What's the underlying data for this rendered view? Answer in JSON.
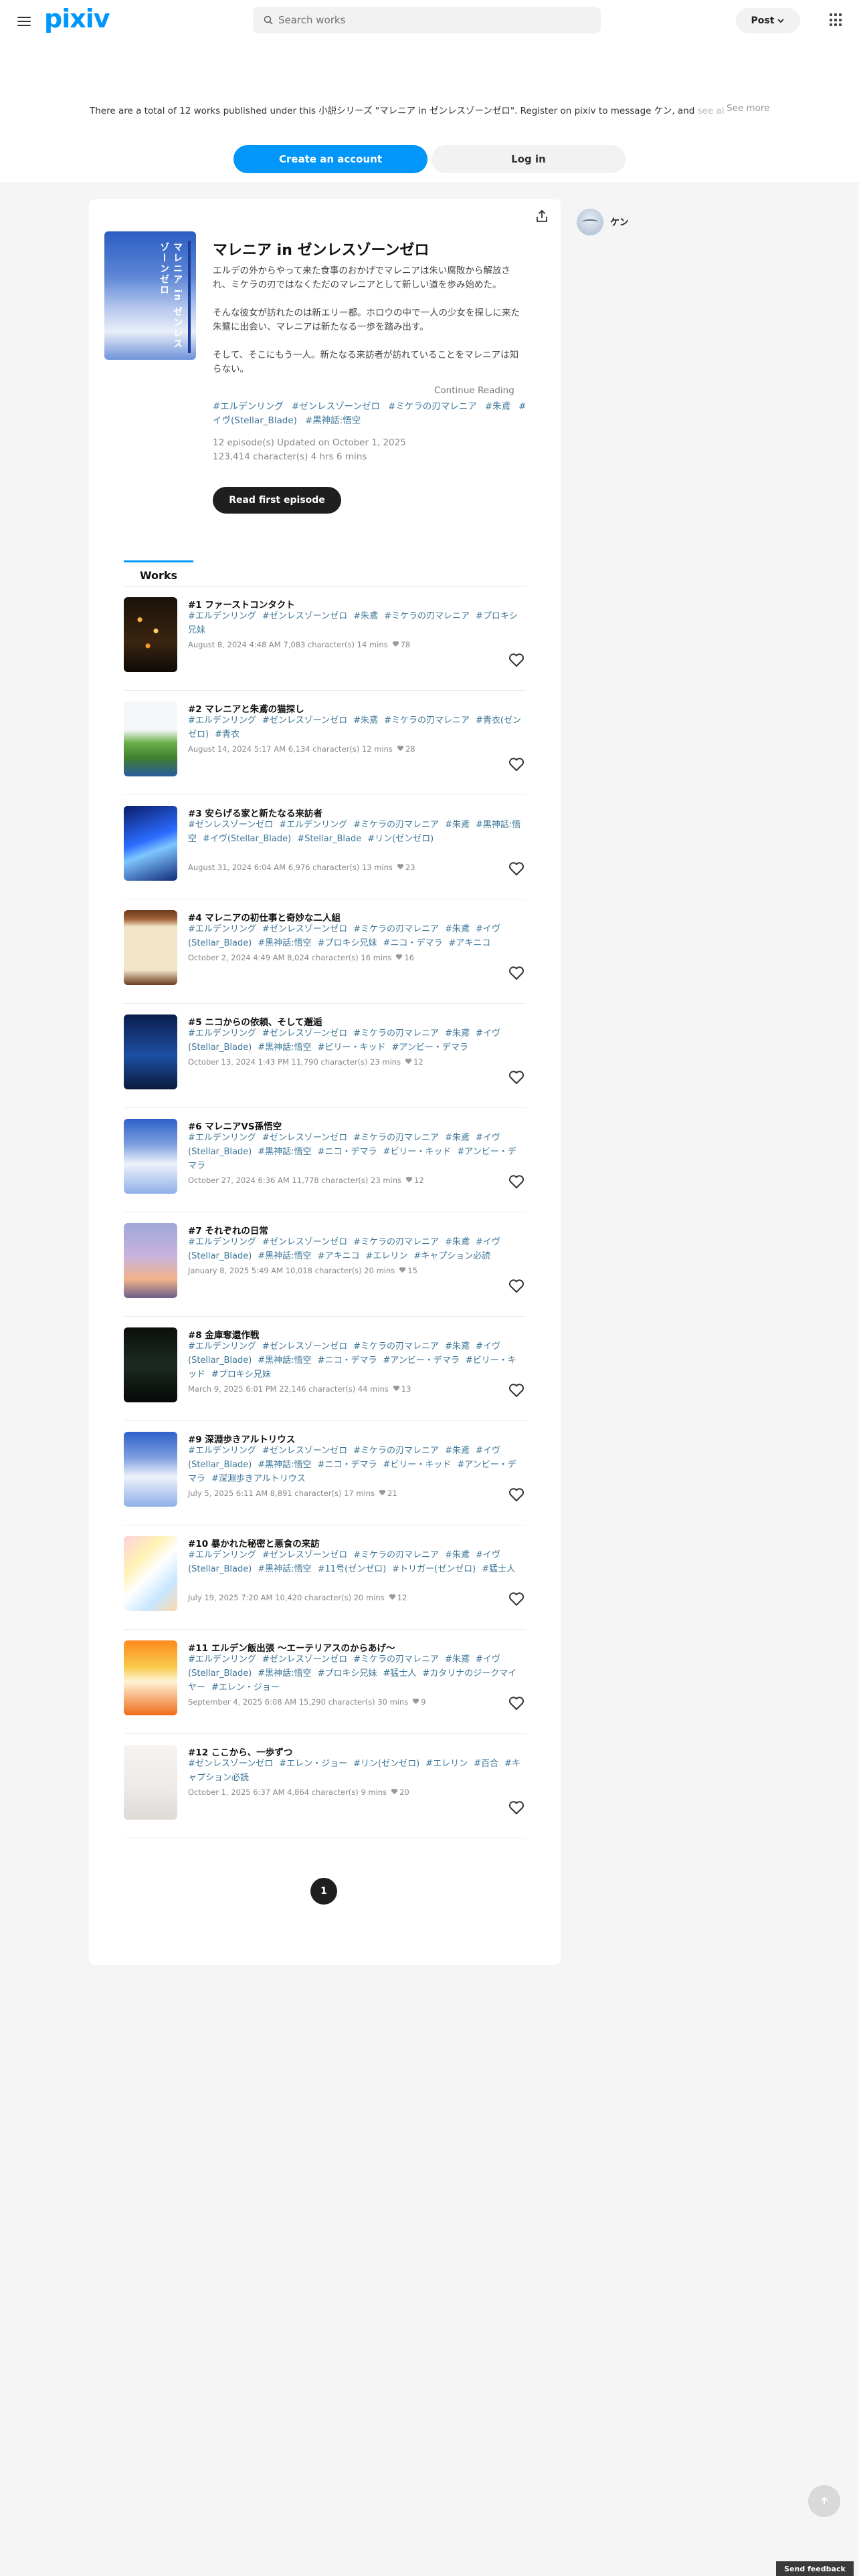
{
  "header": {
    "logo": "pixiv",
    "search_placeholder": "Search works",
    "post_label": "Post"
  },
  "intro": {
    "text": "There are a total of 12 works published under this 小説シリーズ \"マレニア in ゼンレスゾーンゼロ\". Register on pixiv to message ケン, and",
    "text_fade": " see all series",
    "see_more": "See more",
    "create_account": "Create an account",
    "log_in": "Log in"
  },
  "series": {
    "cover_title": "マレニア in ゼンレスゾーンゼロ",
    "title": "マレニア in ゼンレスゾーンゼロ",
    "desc1": "エルデの外からやって来た食事のおかげでマレニアは朱い腐敗から解放され、ミケラの刃ではなくただのマレニアとして新しい道を歩み始めた。",
    "desc2": "そんな彼女が訪れたのは新エリー都。ホロウの中で一人の少女を探しに来た朱鷺に出会い、マレニアは新たなる一歩を踏み出す。",
    "desc3": "そして、そこにもう一人。新たなる来訪者が訪れていることをマレニアは知らない。",
    "continue_reading": "Continue Reading",
    "tags": [
      "#エルデンリング",
      "#ゼンレスゾーンゼロ",
      "#ミケラの刃マレニア",
      "#朱鳶",
      "#イヴ(Stellar_Blade)",
      "#黒神話:悟空"
    ],
    "meta_line1": "12 episode(s)  Updated on October 1, 2025",
    "meta_line2": "123,414 character(s)  4 hrs 6 mins",
    "read_first": "Read first episode"
  },
  "tabs": {
    "works": "Works"
  },
  "episodes": [
    {
      "title": "#1 ファーストコンタクト",
      "tags": [
        "#エルデンリング",
        "#ゼンレスゾーンゼロ",
        "#朱鳶",
        "#ミケラの刃マレニア",
        "#プロキシ兄妹"
      ],
      "meta": "August 8, 2024 4:48 AM  7,083 character(s)  14 mins",
      "likes": "78"
    },
    {
      "title": "#2 マレニアと朱鳶の猫探し",
      "tags": [
        "#エルデンリング",
        "#ゼンレスゾーンゼロ",
        "#朱鳶",
        "#ミケラの刃マレニア",
        "#青衣(ゼンゼロ)",
        "#青衣"
      ],
      "meta": "August 14, 2024 5:17 AM  6,134 character(s)  12 mins",
      "likes": "28"
    },
    {
      "title": "#3 安らげる家と新たなる来訪者",
      "tags": [
        "#ゼンレスゾーンゼロ",
        "#エルデンリング",
        "#ミケラの刃マレニア",
        "#朱鳶",
        "#黒神話:悟空",
        "#イヴ(Stellar_Blade)",
        "#Stellar_Blade",
        "#リン(ゼンゼロ)"
      ],
      "meta": "August 31, 2024 6:04 AM  6,976 character(s)  13 mins",
      "likes": "23"
    },
    {
      "title": "#4 マレニアの初仕事と奇妙な二人組",
      "tags": [
        "#エルデンリング",
        "#ゼンレスゾーンゼロ",
        "#ミケラの刃マレニア",
        "#朱鳶",
        "#イヴ(Stellar_Blade)",
        "#黒神話:悟空",
        "#プロキシ兄妹",
        "#ニコ・デマラ",
        "#アキニコ"
      ],
      "meta": "October 2, 2024 4:49 AM  8,024 character(s)  16 mins",
      "likes": "16"
    },
    {
      "title": "#5 ニコからの依頼、そして邂逅",
      "tags": [
        "#エルデンリング",
        "#ゼンレスゾーンゼロ",
        "#ミケラの刃マレニア",
        "#朱鳶",
        "#イヴ(Stellar_Blade)",
        "#黒神話:悟空",
        "#ビリー・キッド",
        "#アンビー・デマラ"
      ],
      "meta": "October 13, 2024 1:43 PM  11,790 character(s)  23 mins",
      "likes": "12"
    },
    {
      "title": "#6 マレニアVS孫悟空",
      "tags": [
        "#エルデンリング",
        "#ゼンレスゾーンゼロ",
        "#ミケラの刃マレニア",
        "#朱鳶",
        "#イヴ(Stellar_Blade)",
        "#黒神話:悟空",
        "#ニコ・デマラ",
        "#ビリー・キッド",
        "#アンビー・デマラ"
      ],
      "meta": "October 27, 2024 6:36 AM  11,778 character(s)  23 mins",
      "likes": "12"
    },
    {
      "title": "#7 それぞれの日常",
      "tags": [
        "#エルデンリング",
        "#ゼンレスゾーンゼロ",
        "#ミケラの刃マレニア",
        "#朱鳶",
        "#イヴ(Stellar_Blade)",
        "#黒神話:悟空",
        "#アキニコ",
        "#エレリン",
        "#キャプション必読"
      ],
      "meta": "January 8, 2025 5:49 AM  10,018 character(s)  20 mins",
      "likes": "15"
    },
    {
      "title": "#8 金庫奪還作戦",
      "tags": [
        "#エルデンリング",
        "#ゼンレスゾーンゼロ",
        "#ミケラの刃マレニア",
        "#朱鳶",
        "#イヴ(Stellar_Blade)",
        "#黒神話:悟空",
        "#ニコ・デマラ",
        "#アンビー・デマラ",
        "#ビリー・キッド",
        "#プロキシ兄妹"
      ],
      "meta": "March 9, 2025 6:01 PM  22,146 character(s)  44 mins",
      "likes": "13"
    },
    {
      "title": "#9 深淵歩きアルトリウス",
      "tags": [
        "#エルデンリング",
        "#ゼンレスゾーンゼロ",
        "#ミケラの刃マレニア",
        "#朱鳶",
        "#イヴ(Stellar_Blade)",
        "#黒神話:悟空",
        "#ニコ・デマラ",
        "#ビリー・キッド",
        "#アンビー・デマラ",
        "#深淵歩きアルトリウス"
      ],
      "meta": "July 5, 2025 6:11 AM  8,891 character(s)  17 mins",
      "likes": "21"
    },
    {
      "title": "#10 暴かれた秘密と悪食の来訪",
      "tags": [
        "#エルデンリング",
        "#ゼンレスゾーンゼロ",
        "#ミケラの刃マレニア",
        "#朱鳶",
        "#イヴ(Stellar_Blade)",
        "#黒神話:悟空",
        "#11号(ゼンゼロ)",
        "#トリガー(ゼンゼロ)",
        "#猛士人"
      ],
      "meta": "July 19, 2025 7:20 AM  10,420 character(s)  20 mins",
      "likes": "12"
    },
    {
      "title": "#11 エルデン飯出張 ～エーテリアスのからあげ～",
      "tags": [
        "#エルデンリング",
        "#ゼンレスゾーンゼロ",
        "#ミケラの刃マレニア",
        "#朱鳶",
        "#イヴ(Stellar_Blade)",
        "#黒神話:悟空",
        "#プロキシ兄妹",
        "#猛士人",
        "#カタリナのジークマイヤー",
        "#エレン・ジョー"
      ],
      "meta": "September 4, 2025 6:08 AM  15,290 character(s)  30 mins",
      "likes": "9"
    },
    {
      "title": "#12 ここから、一歩ずつ",
      "tags": [
        "#ゼンレスゾーンゼロ",
        "#エレン・ジョー",
        "#リン(ゼンゼロ)",
        "#エレリン",
        "#百合",
        "#キャプション必読"
      ],
      "meta": "October 1, 2025 6:37 AM  4,864 character(s)  9 mins",
      "likes": "20"
    }
  ],
  "pagination": {
    "current": "1"
  },
  "author": {
    "name": "ケン"
  },
  "footer": {
    "feedback": "Send feedback"
  },
  "colors": {
    "accent": "#0096fa",
    "tag": "#3d7699",
    "dark_button": "#1f1f1f"
  },
  "icons": {
    "menu": "hamburger-icon",
    "search": "search-icon",
    "apps": "grid-icon",
    "share": "share-icon",
    "like": "heart-icon",
    "top": "arrow-up-icon"
  }
}
